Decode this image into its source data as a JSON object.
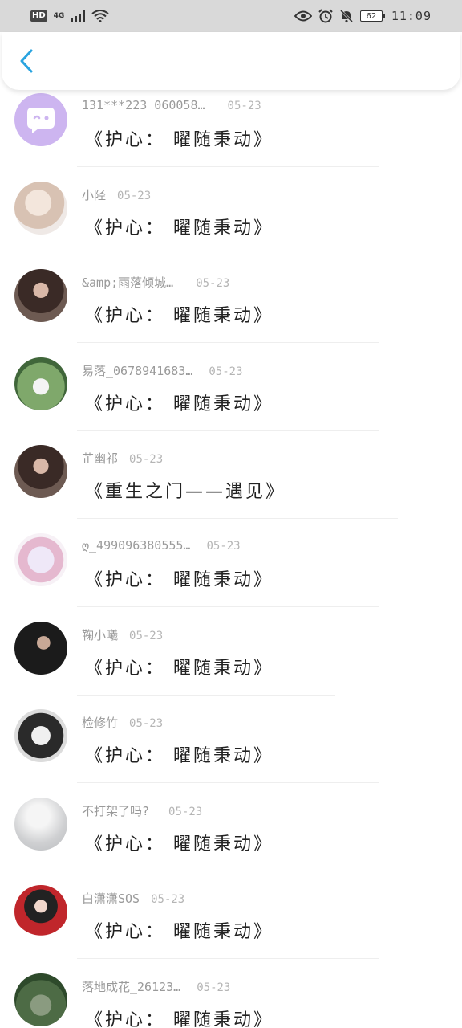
{
  "status_bar": {
    "hd": "HD",
    "network": "4G",
    "battery": "62",
    "time": "11:09"
  },
  "header": {
    "back_icon": "chevron-left-icon",
    "accent_color": "#2aa4e0"
  },
  "rows": [
    {
      "name": "131***223_060058…",
      "date": "05-23",
      "title": "《护心： 曜随秉动》",
      "avatar": "bubble"
    },
    {
      "name": "小陉",
      "date": "05-23",
      "title": "《护心： 曜随秉动》",
      "avatar": "light"
    },
    {
      "name": "&amp;雨落倾城…",
      "date": "05-23",
      "title": "《护心： 曜随秉动》",
      "avatar": "dark"
    },
    {
      "name": "易落_0678941683…",
      "date": "05-23",
      "title": "《护心： 曜随秉动》",
      "avatar": "green"
    },
    {
      "name": "芷幽祁",
      "date": "05-23",
      "title": "《重生之门——遇见》",
      "avatar": "dark"
    },
    {
      "name": "ღ_499096380555…",
      "date": "05-23",
      "title": "《护心： 曜随秉动》",
      "avatar": "flower"
    },
    {
      "name": "鞠小曦",
      "date": "05-23",
      "title": "《护心： 曜随秉动》",
      "avatar": "suit"
    },
    {
      "name": "检修竹",
      "date": "05-23",
      "title": "《护心： 曜随秉动》",
      "avatar": "anime"
    },
    {
      "name": "不打架了吗?",
      "date": "05-23",
      "title": "《护心： 曜随秉动》",
      "avatar": "grey"
    },
    {
      "name": "白潇潇SOS",
      "date": "05-23",
      "title": "《护心： 曜随秉动》",
      "avatar": "red"
    },
    {
      "name": "落地成花_26123…",
      "date": "05-23",
      "title": "《护心： 曜随秉动》",
      "avatar": "forest"
    }
  ]
}
